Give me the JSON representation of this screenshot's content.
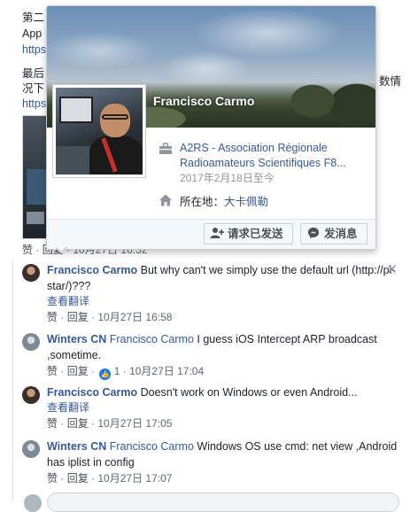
{
  "post": {
    "lines": [
      "第二",
      "App",
      "https",
      "最后",
      "况下",
      "https"
    ],
    "right_fragments": [
      "数情"
    ],
    "meta": {
      "like": "赞",
      "reply": "回复",
      "time": "10月27日 16:52"
    }
  },
  "hovercard": {
    "name": "Francisco Carmo",
    "work": {
      "org_line1": "A2RS - Association Régionale",
      "org_line2": "Radioamateurs Scientifiques F8...",
      "since": "2017年2月18日至今"
    },
    "location": {
      "label": "所在地：",
      "place": "大卡佩勒"
    },
    "buttons": {
      "friend_request": "请求已发送",
      "message": "发消息"
    },
    "icons": {
      "work": "briefcase-icon",
      "location": "home-icon",
      "friend": "add-friend-icon",
      "messenger": "messenger-icon"
    },
    "colors": {
      "link": "#385898",
      "footer_bg": "#f6f7f9"
    }
  },
  "comments": [
    {
      "author": "Francisco Carmo",
      "mention": "",
      "text": "But why can't we simply use the default url (http://pi-star/)???",
      "translate": "查看翻译",
      "like": "赞",
      "reply": "回复",
      "reactions": "",
      "time": "10月27日 16:58"
    },
    {
      "author": "Winters CN",
      "mention": "Francisco Carmo",
      "text": "I guess iOS Intercept ARP broadcast ,sometime.",
      "translate": "",
      "like": "赞",
      "reply": "回复",
      "reactions": "1",
      "time": "10月27日 17:04"
    },
    {
      "author": "Francisco Carmo",
      "mention": "",
      "text": "Doesn't work on Windows or even Android...",
      "translate": "查看翻译",
      "like": "赞",
      "reply": "回复",
      "reactions": "",
      "time": "10月27日 17:05"
    },
    {
      "author": "Winters CN",
      "mention": "Francisco Carmo",
      "text": "Windows OS use cmd: net view ,Android has iplist in config",
      "translate": "",
      "like": "赞",
      "reply": "回复",
      "reactions": "",
      "time": "10月27日 17:07"
    }
  ],
  "separator": " · ",
  "close_glyph": "✕"
}
